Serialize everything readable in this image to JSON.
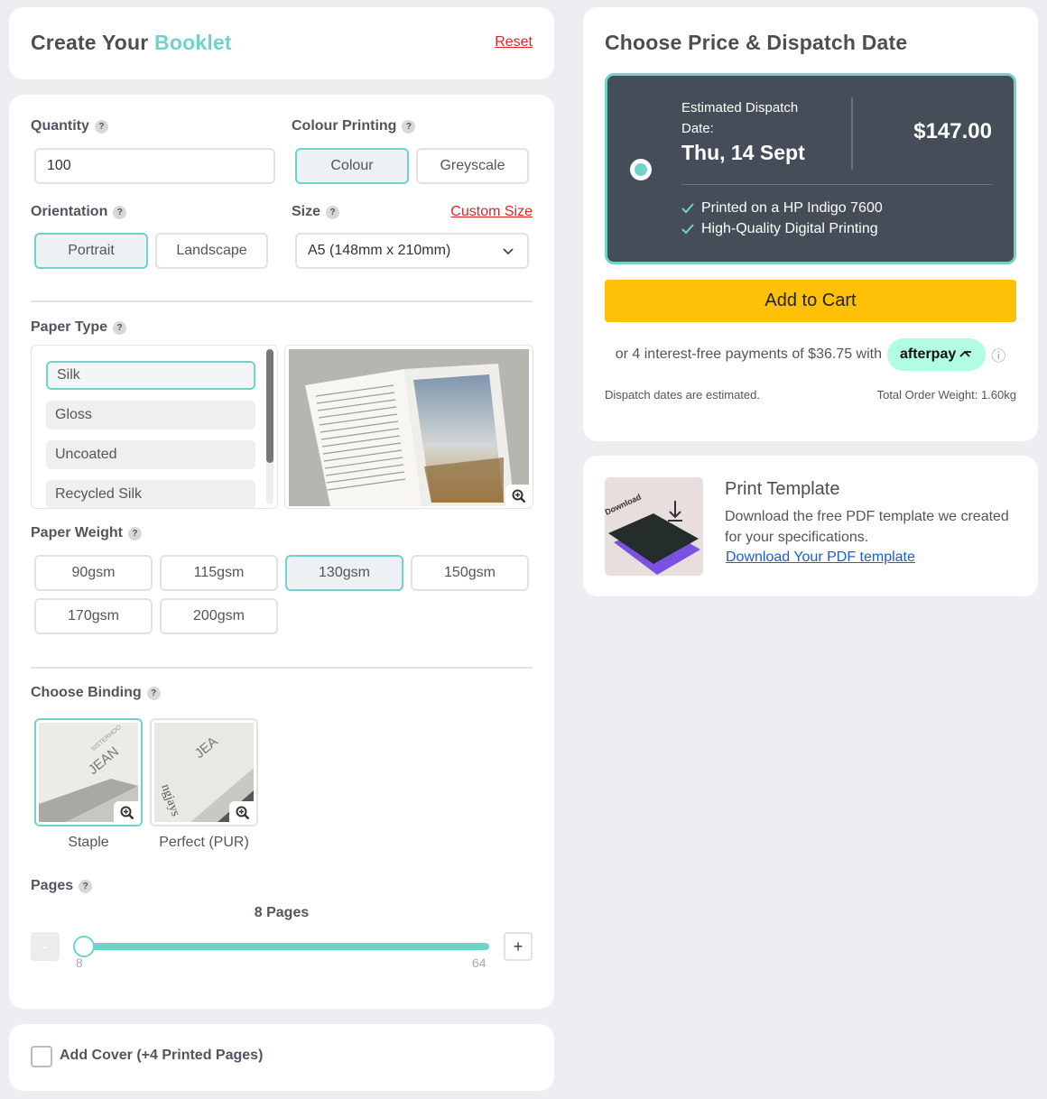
{
  "header": {
    "title_prefix": "Create Your",
    "title_accent": "Booklet",
    "reset_label": "Reset"
  },
  "options": {
    "quantity_label": "Quantity",
    "quantity_value": "100",
    "colour_label": "Colour Printing",
    "colour_options": [
      "Colour",
      "Greyscale"
    ],
    "colour_selected": "Colour",
    "orientation_label": "Orientation",
    "orientation_options": [
      "Portrait",
      "Landscape"
    ],
    "orientation_selected": "Portrait",
    "size_label": "Size",
    "custom_size_label": "Custom Size",
    "size_value": "A5 (148mm x 210mm)",
    "paper_type_label": "Paper Type",
    "paper_types": [
      "Silk",
      "Gloss",
      "Uncoated",
      "Recycled Silk"
    ],
    "paper_type_selected": "Silk",
    "paper_weight_label": "Paper Weight",
    "paper_weights": [
      "90gsm",
      "115gsm",
      "130gsm",
      "150gsm",
      "170gsm",
      "200gsm"
    ],
    "paper_weight_selected": "130gsm",
    "binding_label": "Choose Binding",
    "bindings": [
      "Staple",
      "Perfect (PUR)"
    ],
    "binding_selected": "Staple",
    "pages_label": "Pages",
    "pages_display": "8 Pages",
    "pages_min": "8",
    "pages_max": "64",
    "pages_value": 8,
    "minus_label": "-",
    "plus_label": "+"
  },
  "cover": {
    "label": "Add Cover (+4 Printed Pages)"
  },
  "price": {
    "title": "Choose Price & Dispatch Date",
    "dispatch_label": "Estimated Dispatch Date:",
    "dispatch_date": "Thu, 14 Sept",
    "amount": "$147.00",
    "features": [
      "Printed on a HP Indigo 7600",
      "High-Quality Digital Printing"
    ],
    "add_to_cart": "Add to Cart",
    "afterpay_text": "or 4 interest-free payments of $36.75 with",
    "afterpay_brand": "afterpay",
    "info_icon": "ⓘ",
    "disclaimer": "Dispatch dates are estimated.",
    "weight": "Total Order Weight: 1.60kg"
  },
  "template": {
    "title": "Print Template",
    "desc": "Download the free PDF template we created for your specifications.",
    "link": "Download Your PDF template",
    "thumb_text": "Download"
  },
  "colors": {
    "accent": "#6fd3c9",
    "card_dark": "#454d58",
    "cart": "#ffc107",
    "link_red": "#e0242c",
    "link_blue": "#1a5fd6",
    "afterpay": "#b2fce4"
  }
}
